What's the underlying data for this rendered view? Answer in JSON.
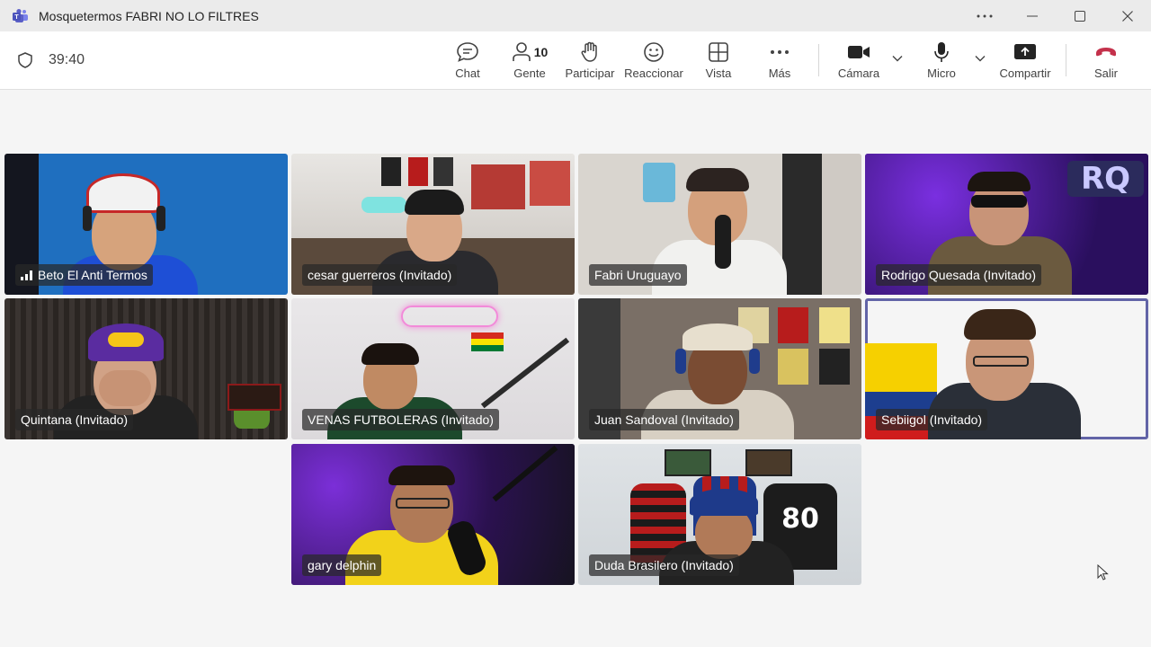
{
  "window": {
    "title": "Mosquetermos FABRI NO LO FILTRES",
    "controls": [
      "more-options",
      "minimize",
      "maximize",
      "close"
    ]
  },
  "toolbar": {
    "timer": "39:40",
    "chat_label": "Chat",
    "people_label": "Gente",
    "people_count": "10",
    "raise_hand_label": "Participar",
    "react_label": "Reaccionar",
    "view_label": "Vista",
    "more_label": "Más",
    "camera_label": "Cámara",
    "mic_label": "Micro",
    "share_label": "Compartir",
    "leave_label": "Salir"
  },
  "colors": {
    "accent": "#6264a7",
    "leave": "#c4314b",
    "teams_icon": "#5b5fc7"
  },
  "participants": [
    {
      "name": "Beto El Anti Termos",
      "signal_icon": "signal-bars-icon"
    },
    {
      "name": "cesar guerreros (Invitado)"
    },
    {
      "name": "Fabri Uruguayo"
    },
    {
      "name": "Rodrigo Quesada (Invitado)",
      "speaking": true
    },
    {
      "name": "Quintana (Invitado)"
    },
    {
      "name": "VENAS FUTBOLERAS (Invitado)"
    },
    {
      "name": "Juan Sandoval (Invitado)",
      "speaking": true
    },
    {
      "name": "Sebiigol (Invitado)",
      "speaking": true
    },
    {
      "name": "gary delphin",
      "speaking": true
    },
    {
      "name": "Duda Brasilero (Invitado)"
    }
  ]
}
